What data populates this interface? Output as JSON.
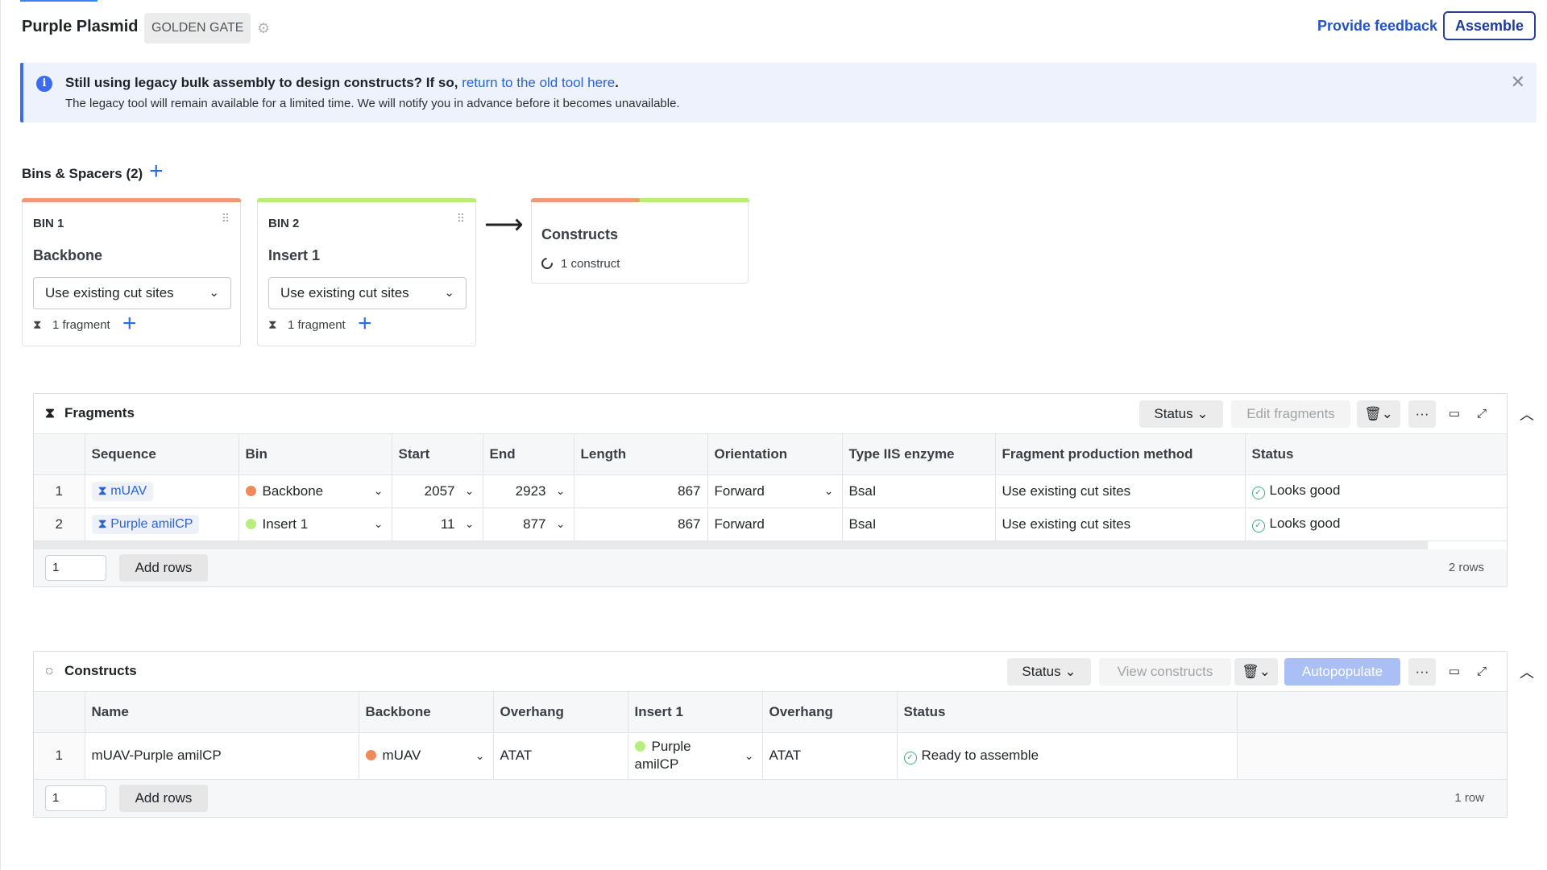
{
  "header": {
    "title": "Purple Plasmid",
    "tag": "GOLDEN GATE",
    "feedback": "Provide feedback",
    "assemble": "Assemble"
  },
  "banner": {
    "line1_prefix": "Still using legacy bulk assembly to design constructs? If so,",
    "line1_link": "return to the old tool here",
    "line1_suffix": ".",
    "line2": "The legacy tool will remain available for a limited time. We will notify you in advance before it becomes unavailable."
  },
  "bins": {
    "title": "Bins & Spacers (2)",
    "items": [
      {
        "label": "BIN 1",
        "name": "Backbone",
        "method": "Use existing cut sites",
        "fragments": "1 fragment",
        "color": "#ef9a73"
      },
      {
        "label": "BIN 2",
        "name": "Insert 1",
        "method": "Use existing cut sites",
        "fragments": "1 fragment",
        "color": "#b6ef7d"
      }
    ],
    "constructs": {
      "title": "Constructs",
      "count": "1 construct"
    }
  },
  "fragments": {
    "title": "Fragments",
    "toolbar": {
      "status": "Status",
      "edit": "Edit fragments"
    },
    "columns": [
      "",
      "Sequence",
      "Bin",
      "Start",
      "End",
      "Length",
      "Orientation",
      "Type IIS enzyme",
      "Fragment production method",
      "Status"
    ],
    "rows": [
      {
        "n": "1",
        "sequence": "mUAV",
        "bin": "Backbone",
        "bin_color": "#ef8a5a",
        "start": "2057",
        "end": "2923",
        "length": "867",
        "orientation": "Forward",
        "enzyme": "BsaI",
        "method": "Use existing cut sites",
        "status": "Looks good"
      },
      {
        "n": "2",
        "sequence": "Purple amilCP",
        "bin": "Insert 1",
        "bin_color": "#b6ef7d",
        "start": "11",
        "end": "877",
        "length": "867",
        "orientation": "Forward",
        "enzyme": "BsaI",
        "method": "Use existing cut sites",
        "status": "Looks good"
      }
    ],
    "footer": {
      "input_value": "1",
      "add_rows": "Add rows",
      "count": "2 rows"
    }
  },
  "constructs": {
    "title": "Constructs",
    "toolbar": {
      "status": "Status",
      "view": "View constructs",
      "autopopulate": "Autopopulate"
    },
    "columns": [
      "",
      "Name",
      "Backbone",
      "Overhang",
      "Insert 1",
      "Overhang",
      "Status"
    ],
    "rows": [
      {
        "n": "1",
        "name": "mUAV-Purple amilCP",
        "backbone": "mUAV",
        "overhang1": "ATAT",
        "insert_line1": "Purple",
        "insert_line2": "amilCP",
        "overhang2": "ATAT",
        "status": "Ready to assemble"
      }
    ],
    "footer": {
      "input_value": "1",
      "add_rows": "Add rows",
      "count": "1 row"
    }
  }
}
